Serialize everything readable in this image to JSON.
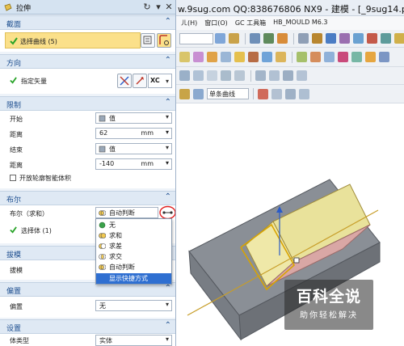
{
  "app": {
    "title": "w.9sug.com QQ:838676806 NX9 - 建模 - [_9sug14.prt] (修改",
    "menu": [
      "ㄦ(H)",
      "窗口(O)",
      "GC 工具箱",
      "HB_MOULD M6.3"
    ],
    "filter_combo": "单条曲线"
  },
  "watermark": {
    "title": "百科全说",
    "subtitle": "助你轻松解决"
  },
  "dialog": {
    "title": "拉伸",
    "sections": {
      "section": {
        "title": "截面",
        "select_curve": "选择曲线 (5)"
      },
      "direction": {
        "title": "方向",
        "specify_vector": "指定矢量",
        "vector_combo": "XC"
      },
      "limits": {
        "title": "限制",
        "start_label": "开始",
        "start_value": "值",
        "distance1_label": "距离",
        "distance1_value": "62",
        "distance1_unit": "mm",
        "end_label": "结束",
        "end_value": "值",
        "distance2_label": "距离",
        "distance2_value": "-140",
        "distance2_unit": "mm",
        "open_profile": "开放轮廓智能体积"
      },
      "boolean": {
        "title": "布尔",
        "boolean_label": "布尔（求和）",
        "boolean_value": "自动判断",
        "select_body": "选择体 (1)",
        "options": [
          "无",
          "求和",
          "求差",
          "求交",
          "自动判断"
        ],
        "shortcut_option": "显示快捷方式"
      },
      "draft": {
        "title": "拔模",
        "draft_label": "拔模"
      },
      "offset": {
        "title": "偏置",
        "offset_label": "偏置",
        "offset_value": "无"
      },
      "settings": {
        "title": "设置",
        "body_type_label": "体类型",
        "body_type_value": "实体"
      }
    }
  },
  "colors": {
    "accent": "#1d4e8f",
    "highlight": "#2f6fd1",
    "selection_row": "#fbe08a",
    "check": "#27a327",
    "annotation_circle": "#e02020"
  }
}
